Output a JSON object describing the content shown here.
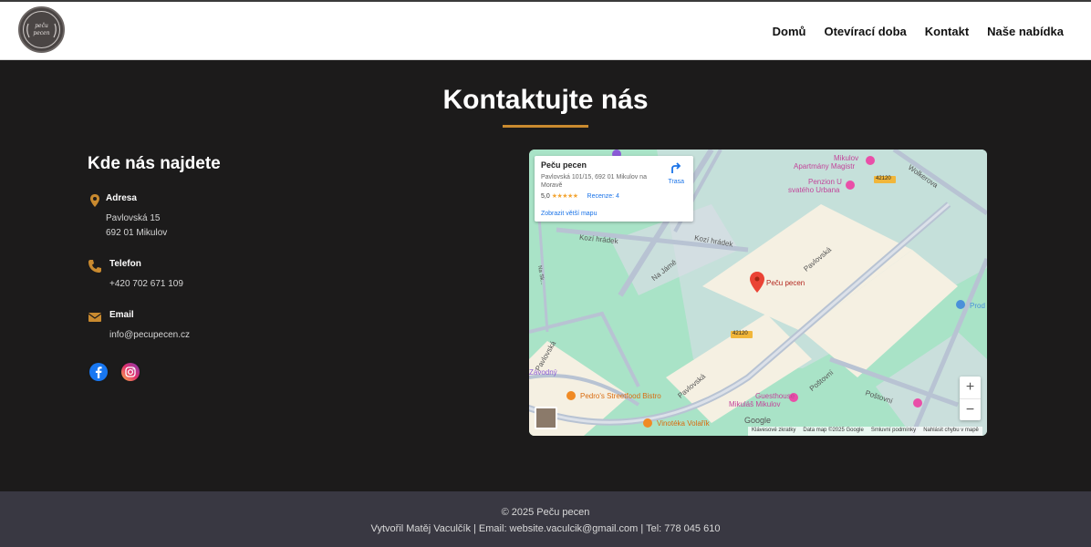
{
  "nav": {
    "items": [
      "Domů",
      "Otevírací doba",
      "Kontakt",
      "Naše nabídka"
    ]
  },
  "page": {
    "title": "Kontaktujte nás",
    "section_title": "Kde nás najdete"
  },
  "contact": {
    "address_label": "Adresa",
    "address_line1": "Pavlovská 15",
    "address_line2": "692 01 Mikulov",
    "phone_label": "Telefon",
    "phone": "+420 702 671 109",
    "email_label": "Email",
    "email": "info@pecupecen.cz"
  },
  "map": {
    "place_name": "Peču pecen",
    "place_address": "Pavlovská 101/15, 692 01 Mikulov na Moravě",
    "rating": "5,0",
    "stars": "★★★★★",
    "reviews": "Recenze: 4",
    "larger_map": "Zobrazit větší mapu",
    "route": "Trasa",
    "pin_label": "Peču pecen",
    "labels": {
      "kozi1": "Kozí hrádek",
      "kozi2": "Kozí hrádek",
      "navaze": "Na Jámě",
      "pavlovska1": "Pavlovská",
      "pavlovska2": "Pavlovská",
      "pavlovska3": "Pavlovská",
      "poštovní1": "Poštovní",
      "poštovní2": "Poštovní",
      "wolkerova": "Wolkerova",
      "zavodny": "Závodný",
      "mikulov_apt": "Mikulov",
      "mikulov_apt2": "Apartmány Magistr",
      "penzion1": "Penzion U",
      "penzion2": "svatého Urbana",
      "pedros": "Pedro's Streetfood Bistro",
      "guesthouse1": "Guesthouse",
      "guesthouse2": "Mikuláš Mikulov",
      "vinoteka": "Vinotéka Volařík",
      "prod": "Prod",
      "road1": "42120",
      "road2": "42120",
      "na_sk": "Na Sk...",
      "google": "Google"
    },
    "attribution": [
      "Klávesové zkratky",
      "Data map ©2025 Google",
      "Smluvní podmínky",
      "Nahlásit chybu v mapě"
    ],
    "zoom_in": "+",
    "zoom_out": "−"
  },
  "footer": {
    "line1": "© 2025 Peču pecen",
    "line2": "Vytvořil Matěj Vaculčík | Email: website.vaculcik@gmail.com | Tel: 778 045 610"
  },
  "colors": {
    "accent": "#c98a2f",
    "background": "#1c1b1b",
    "footer": "#393842"
  }
}
